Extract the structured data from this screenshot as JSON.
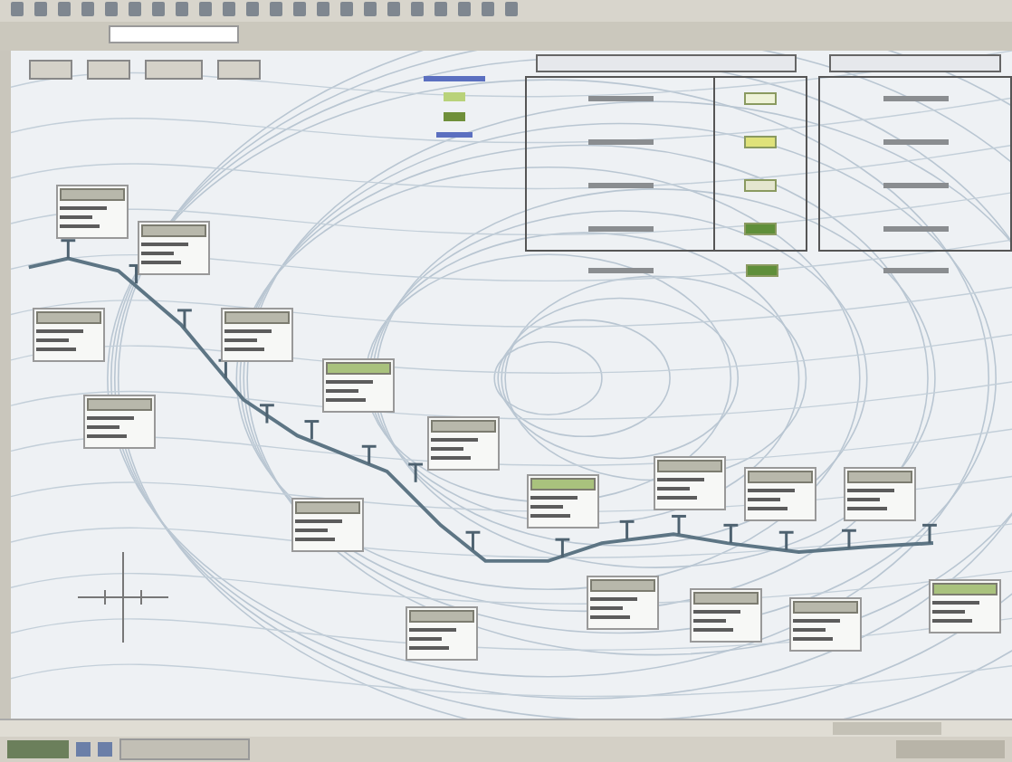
{
  "legend_symbols": [
    {
      "color": "#b9d27a"
    },
    {
      "color": "#6f8f3a"
    }
  ],
  "station_panel_symbols": [
    {
      "color": "#eef2d8"
    },
    {
      "color": "#dfe27a"
    },
    {
      "color": "#e4e6cf"
    },
    {
      "color": "#5f8f3a"
    },
    {
      "color": "#5f8f3a"
    }
  ],
  "label_cards": [
    {
      "color": "#b8b8ab"
    },
    {
      "color": "#b8b8ab"
    },
    {
      "color": "#b8b8ab"
    },
    {
      "color": "#b8b8ab"
    },
    {
      "color": "#b8b8ab"
    },
    {
      "color": "#a9c27d"
    },
    {
      "color": "#b8b8ab"
    },
    {
      "color": "#b8b8ab"
    },
    {
      "color": "#a9c27d"
    },
    {
      "color": "#b8b8ab"
    },
    {
      "color": "#b8b8ab"
    },
    {
      "color": "#b8b8ab"
    },
    {
      "color": "#b8b8ab"
    },
    {
      "color": "#b8b8ab"
    },
    {
      "color": "#b8b8ab"
    },
    {
      "color": "#b8b8ab"
    },
    {
      "color": "#a9c27d"
    }
  ]
}
